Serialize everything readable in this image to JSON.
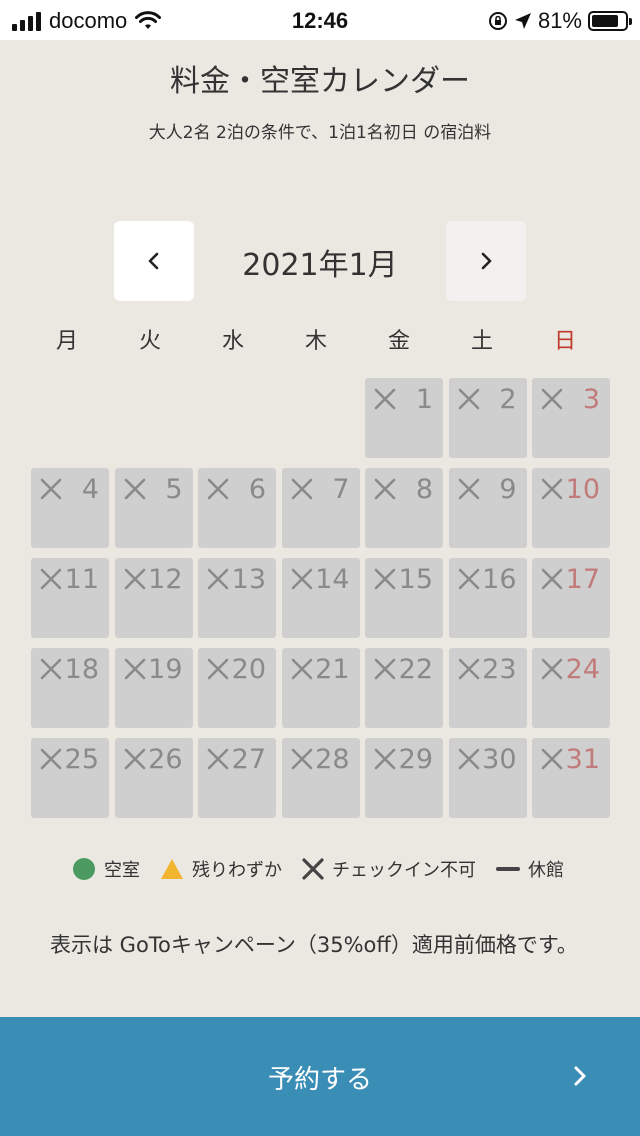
{
  "status_bar": {
    "carrier": "docomo",
    "time": "12:46",
    "battery": "81%",
    "battery_level": 0.81
  },
  "header": {
    "title": "料金・空室カレンダー",
    "subtitle": "大人2名 2泊の条件で、1泊1名初日 の宿泊料"
  },
  "calendar": {
    "month_label": "2021年1月",
    "prev_icon": "chevron-left-icon",
    "next_icon": "chevron-right-icon",
    "weekdays": [
      "月",
      "火",
      "水",
      "木",
      "金",
      "土",
      "日"
    ],
    "leading_blank_days": 4,
    "days": [
      {
        "day": "1",
        "status": "unavailable"
      },
      {
        "day": "2",
        "status": "unavailable"
      },
      {
        "day": "3",
        "status": "unavailable"
      },
      {
        "day": "4",
        "status": "unavailable"
      },
      {
        "day": "5",
        "status": "unavailable"
      },
      {
        "day": "6",
        "status": "unavailable"
      },
      {
        "day": "7",
        "status": "unavailable"
      },
      {
        "day": "8",
        "status": "unavailable"
      },
      {
        "day": "9",
        "status": "unavailable"
      },
      {
        "day": "10",
        "status": "unavailable"
      },
      {
        "day": "11",
        "status": "unavailable"
      },
      {
        "day": "12",
        "status": "unavailable"
      },
      {
        "day": "13",
        "status": "unavailable"
      },
      {
        "day": "14",
        "status": "unavailable"
      },
      {
        "day": "15",
        "status": "unavailable"
      },
      {
        "day": "16",
        "status": "unavailable"
      },
      {
        "day": "17",
        "status": "unavailable"
      },
      {
        "day": "18",
        "status": "unavailable"
      },
      {
        "day": "19",
        "status": "unavailable"
      },
      {
        "day": "20",
        "status": "unavailable"
      },
      {
        "day": "21",
        "status": "unavailable"
      },
      {
        "day": "22",
        "status": "unavailable"
      },
      {
        "day": "23",
        "status": "unavailable"
      },
      {
        "day": "24",
        "status": "unavailable"
      },
      {
        "day": "25",
        "status": "unavailable"
      },
      {
        "day": "26",
        "status": "unavailable"
      },
      {
        "day": "27",
        "status": "unavailable"
      },
      {
        "day": "28",
        "status": "unavailable"
      },
      {
        "day": "29",
        "status": "unavailable"
      },
      {
        "day": "30",
        "status": "unavailable"
      },
      {
        "day": "31",
        "status": "unavailable"
      }
    ]
  },
  "legend": {
    "available": "空室",
    "few_left": "残りわずか",
    "no_checkin": "チェックイン不可",
    "closed": "休館"
  },
  "note": {
    "text": "表示は GoToキャンペーン（35%off）適用前価格です。"
  },
  "reserve_button": {
    "label": "予約する"
  },
  "colors": {
    "background": "#ebe8e2",
    "cell": "#cfcfcf",
    "sunday": "#c0392b",
    "available_green": "#4a9a62",
    "few_left_yellow": "#f2b531",
    "button": "#3a8db5"
  }
}
